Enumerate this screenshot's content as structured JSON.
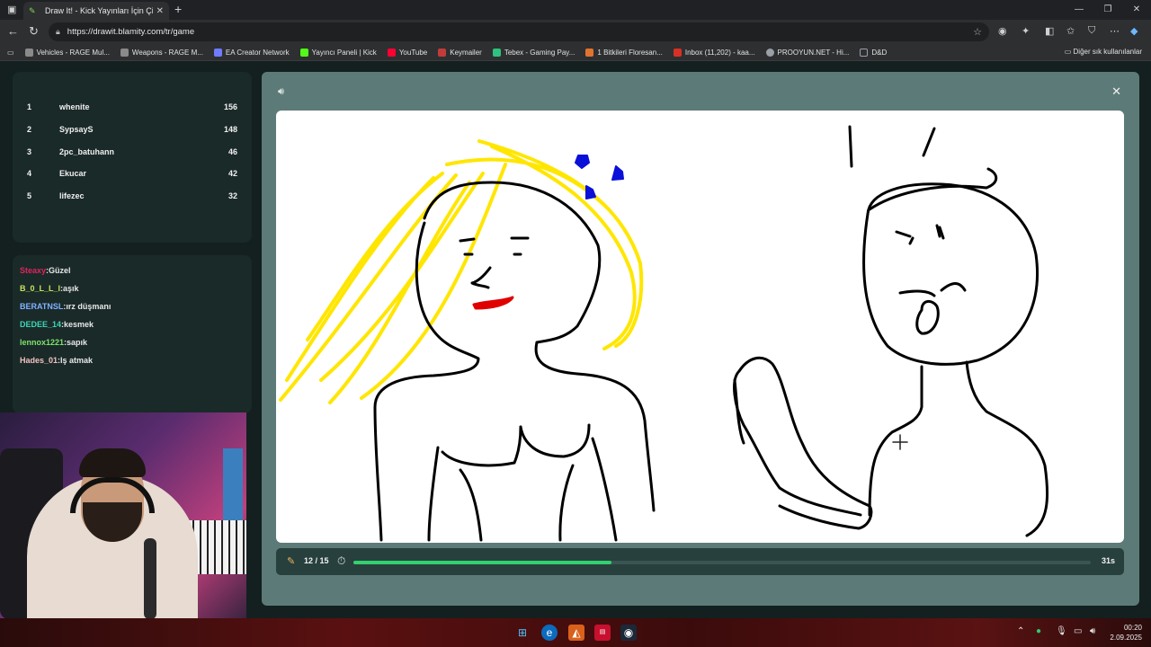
{
  "browser": {
    "tab_title": "Draw It! - Kick Yayınları İçin Çizim",
    "url": "https://drawit.blamity.com/tr/game",
    "bookmarks": [
      {
        "label": "Vehicles - RAGE Mul...",
        "color": "#8a8a8a"
      },
      {
        "label": "Weapons - RAGE M...",
        "color": "#8a8a8a"
      },
      {
        "label": "EA Creator Network",
        "color": "#6f7cff"
      },
      {
        "label": "Yayıncı Paneli | Kick",
        "color": "#53fc18"
      },
      {
        "label": "YouTube",
        "color": "#ff0033"
      },
      {
        "label": "Keymailer",
        "color": "#c23b3b"
      },
      {
        "label": "Tebex - Gaming Pay...",
        "color": "#2ec27e"
      },
      {
        "label": "1 Bitkileri Floresan...",
        "color": "#e0742f"
      },
      {
        "label": "Inbox (11,202) - kaa...",
        "color": "#d93025"
      },
      {
        "label": "PROOYUN.NET - Hi...",
        "color": "#9aa0a6"
      },
      {
        "label": "D&D",
        "color": "#9aa0a6"
      }
    ],
    "other_bookmarks": "Diğer sık kullanılanlar"
  },
  "scoreboard": [
    {
      "rank": "1",
      "name": "whenite",
      "points": "156"
    },
    {
      "rank": "2",
      "name": "SypsayS",
      "points": "148"
    },
    {
      "rank": "3",
      "name": "2pc_batuhann",
      "points": "46"
    },
    {
      "rank": "4",
      "name": "Ekucar",
      "points": "42"
    },
    {
      "rank": "5",
      "name": "lifezec",
      "points": "32"
    }
  ],
  "chat": [
    {
      "user": "Steaxy",
      "msg": "Güzel",
      "color": "#e0245e"
    },
    {
      "user": "B_0_L_L_l",
      "msg": "aşık",
      "color": "#c6e45a"
    },
    {
      "user": "BERATNSL",
      "msg": "ırz düşmanı",
      "color": "#7fb2ff"
    },
    {
      "user": "DEDEE_14",
      "msg": "kesmek",
      "color": "#3ed6b5"
    },
    {
      "user": "lennox1221",
      "msg": "sapık",
      "color": "#7ee36b"
    },
    {
      "user": "Hades_01",
      "msg": "Iş atmak",
      "color": "#f0c2c2"
    }
  ],
  "game": {
    "round": "12 / 15",
    "time_left": "31s",
    "progress_fraction": 0.35
  },
  "taskbar": {
    "time": "00:20",
    "date": "2.09.2025"
  }
}
